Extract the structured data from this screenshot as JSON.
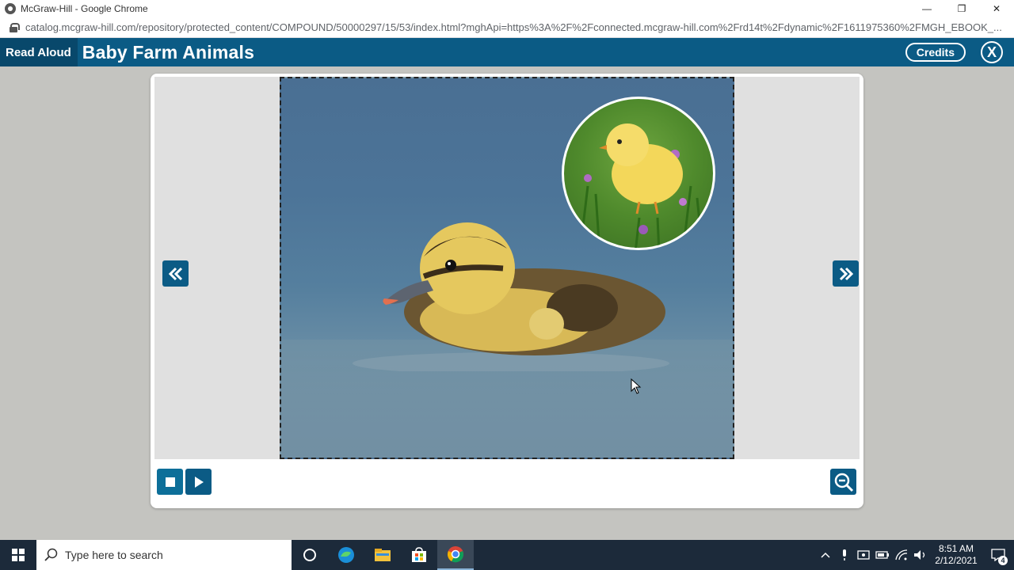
{
  "browser": {
    "window_title": "McGraw-Hill - Google Chrome",
    "url": "catalog.mcgraw-hill.com/repository/protected_content/COMPOUND/50000297/15/53/index.html?mghApi=https%3A%2F%2Fconnected.mcgraw-hill.com%2Frd14t%2Fdynamic%2F1611975360%2FMGH_EBOOK_..."
  },
  "app": {
    "mode_label": "Read Aloud",
    "book_title": "Baby Farm Animals",
    "credits_label": "Credits",
    "close_label": "X"
  },
  "taskbar": {
    "search_placeholder": "Type here to search",
    "time": "8:51 AM",
    "date": "2/12/2021",
    "notification_count": "4"
  },
  "colors": {
    "brand": "#0b5b85",
    "brand_dark": "#08486b",
    "taskbar": "#1c2a3a"
  },
  "icons": [
    "lock-icon",
    "prev-page-icon",
    "next-page-icon",
    "stop-icon",
    "play-icon",
    "zoom-out-icon",
    "windows-start-icon",
    "search-icon",
    "cortana-icon",
    "edge-icon",
    "file-explorer-icon",
    "store-icon",
    "chrome-icon"
  ]
}
